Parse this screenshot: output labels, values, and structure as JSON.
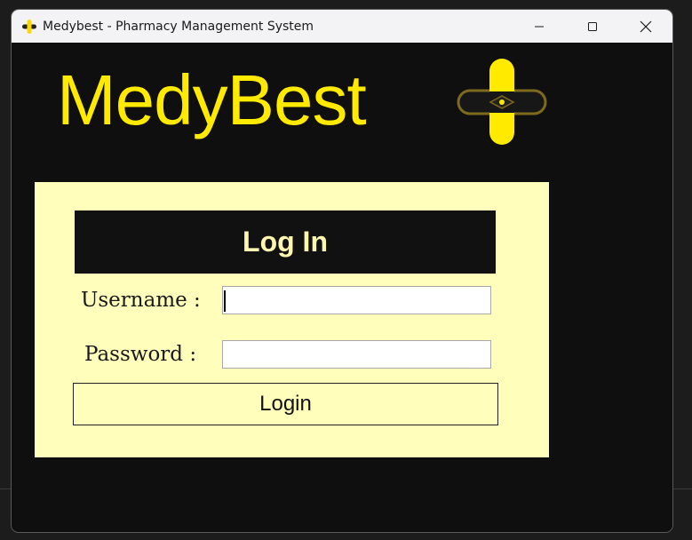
{
  "window": {
    "title": "Medybest - Pharmacy Management System",
    "app_icon": "medybest-logo-icon",
    "controls": [
      "minimize-icon",
      "maximize-icon",
      "close-icon"
    ]
  },
  "brand": {
    "name": "MedyBest",
    "color": "#ffea00",
    "logo": "medybest-logo-icon"
  },
  "login": {
    "header": "Log In",
    "username_label": "Username :",
    "username_value": "",
    "password_label": "Password :",
    "password_value": "",
    "button_label": "Login",
    "panel_color": "#ffffbb",
    "header_color": "#111111"
  }
}
